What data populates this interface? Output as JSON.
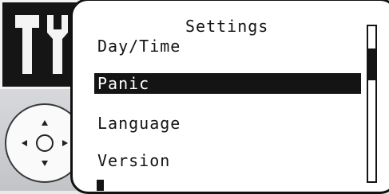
{
  "screen": {
    "title": "Settings",
    "menu_items": [
      {
        "label": "Day/Time",
        "selected": false
      },
      {
        "label": "Panic",
        "selected": true
      },
      {
        "label": "Language",
        "selected": false
      },
      {
        "label": "Version",
        "selected": false
      }
    ]
  },
  "icons": {
    "tools": "tools-icon",
    "dpad": "dpad-icon"
  },
  "colors": {
    "screen_bg": "#ffffff",
    "ink": "#141414",
    "bezel": "#d3d5d8"
  },
  "scroll": {
    "position_fraction": 0.18
  }
}
